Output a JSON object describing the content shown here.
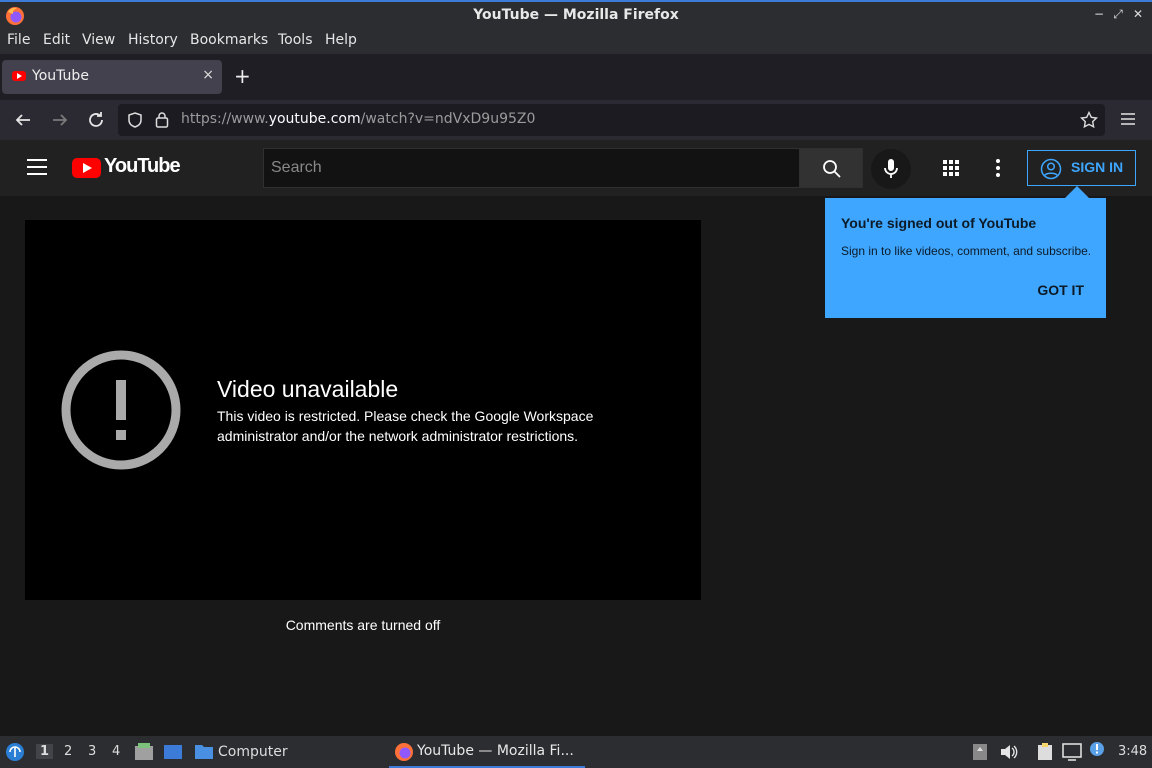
{
  "window": {
    "title": "YouTube — Mozilla Firefox",
    "min": "−",
    "max": "⤢",
    "close": "✕"
  },
  "menu": [
    "File",
    "Edit",
    "View",
    "History",
    "Bookmarks",
    "Tools",
    "Help"
  ],
  "tab": {
    "label": "YouTube",
    "close": "×",
    "new_tab": "+"
  },
  "nav": {
    "url_prefix": "https://www.",
    "url_domain": "youtube.com",
    "url_path": "/watch?v=ndVxD9u95Z0"
  },
  "youtube": {
    "logo_text": "YouTube",
    "search_placeholder": "Search",
    "sign_in": "SIGN IN"
  },
  "player": {
    "error_title": "Video unavailable",
    "error_message": "This video is restricted. Please check the Google Workspace administrator and/or the network administrator restrictions."
  },
  "comments_note": "Comments are turned off",
  "tooltip": {
    "title": "You're signed out of YouTube",
    "body": "Sign in to like videos, comment, and subscribe.",
    "button": "GOT IT"
  },
  "taskbar": {
    "workspaces": [
      "1",
      "2",
      "3",
      "4"
    ],
    "active_workspace": "1",
    "computer_label": "Computer",
    "task_label": "YouTube — Mozilla Fi...",
    "clock": "3:48"
  },
  "colors": {
    "yt_red": "#ff0000",
    "accent_blue": "#3ea6ff",
    "wm_accent": "#3d7bd8"
  }
}
